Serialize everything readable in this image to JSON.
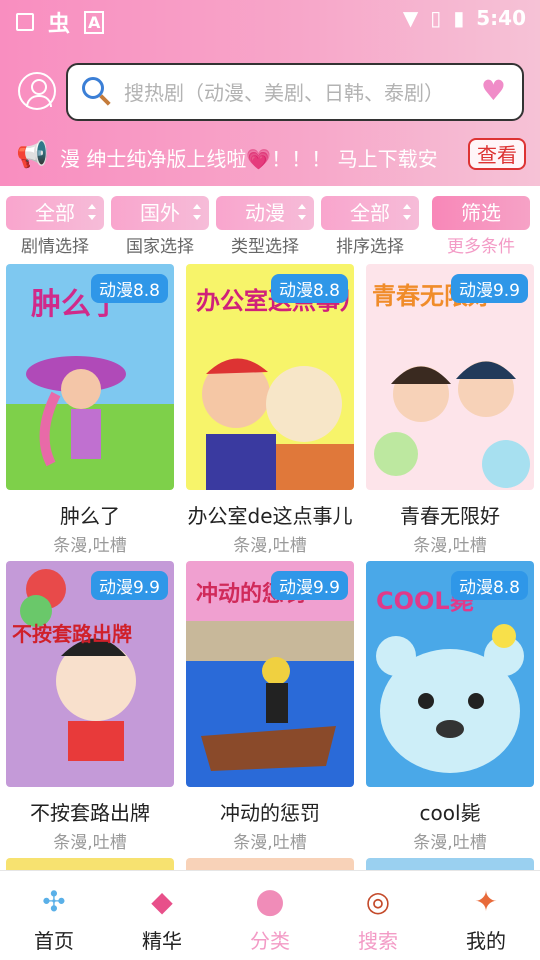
{
  "status_bar": {
    "time": "5:40",
    "left_icons": [
      "image-icon",
      "app-icon",
      "font-icon"
    ],
    "right_icons": [
      "wifi-icon",
      "no-sim-icon",
      "battery-charging-icon"
    ]
  },
  "search": {
    "placeholder": "搜热剧（动漫、美剧、日韩、泰剧）"
  },
  "notice": {
    "text": "漫 绅士纯净版上线啦💗！！！  马上下载安",
    "button": "查看"
  },
  "filters": [
    {
      "value": "全部",
      "label": "剧情选择"
    },
    {
      "value": "国外",
      "label": "国家选择"
    },
    {
      "value": "动漫",
      "label": "类型选择"
    },
    {
      "value": "全部",
      "label": "排序选择"
    }
  ],
  "more_filter": {
    "value": "筛选",
    "label": "更多条件"
  },
  "cards": [
    {
      "title": "肿么了",
      "tags": "条漫,吐槽",
      "badge": "动漫8.8",
      "art_text": "肿么了"
    },
    {
      "title": "办公室de这点事儿",
      "tags": "条漫,吐槽",
      "badge": "动漫8.8",
      "art_text": "办公室这点事儿"
    },
    {
      "title": "青春无限好",
      "tags": "条漫,吐槽",
      "badge": "动漫9.9",
      "art_text": "青春无限好"
    },
    {
      "title": "不按套路出牌",
      "tags": "条漫,吐槽",
      "badge": "动漫9.9",
      "art_text": "不按套路出牌"
    },
    {
      "title": "冲动的惩罚",
      "tags": "条漫,吐槽",
      "badge": "动漫9.9",
      "art_text": "冲动的惩罚"
    },
    {
      "title": "cool毙",
      "tags": "条漫,吐槽",
      "badge": "动漫8.8",
      "art_text": "COOL毙"
    }
  ],
  "tabs": [
    {
      "label": "首页",
      "icon": "pinwheel-icon"
    },
    {
      "label": "精华",
      "icon": "diamond-icon"
    },
    {
      "label": "分类",
      "icon": "location-pin-icon",
      "active": true
    },
    {
      "label": "搜索",
      "icon": "target-icon",
      "active": true
    },
    {
      "label": "我的",
      "icon": "candy-icon"
    }
  ],
  "colors": {
    "header_pink": "#f98ec0",
    "badge_blue": "#2f97e8",
    "active_pink": "#f39bc6"
  }
}
